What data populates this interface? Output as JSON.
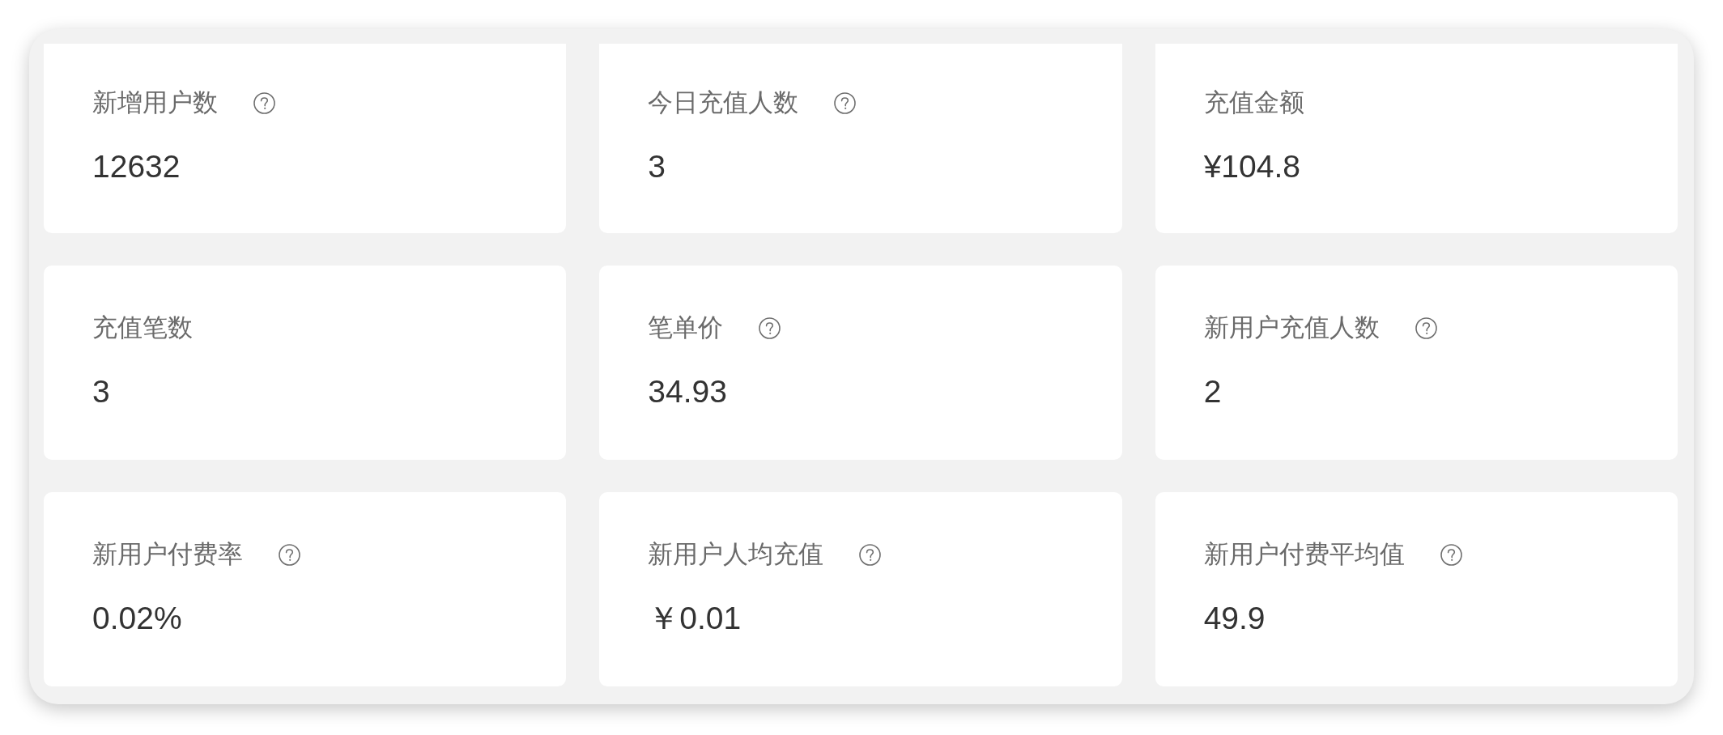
{
  "stats": [
    {
      "label": "新增用户数",
      "help": true,
      "value": "12632"
    },
    {
      "label": "今日充值人数",
      "help": true,
      "value": "3"
    },
    {
      "label": "充值金额",
      "help": false,
      "value": "¥104.8"
    },
    {
      "label": "充值笔数",
      "help": false,
      "value": "3"
    },
    {
      "label": "笔单价",
      "help": true,
      "value": "34.93"
    },
    {
      "label": "新用户充值人数",
      "help": true,
      "value": "2"
    },
    {
      "label": "新用户付费率",
      "help": true,
      "value": "0.02%"
    },
    {
      "label": "新用户人均充值",
      "help": true,
      "value": "￥0.01"
    },
    {
      "label": "新用户付费平均值",
      "help": true,
      "value": "49.9"
    }
  ]
}
